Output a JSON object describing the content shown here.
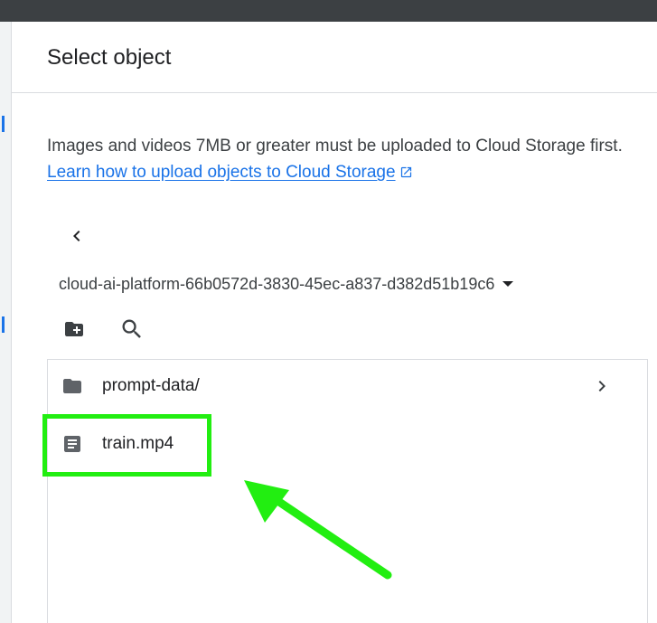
{
  "dialog": {
    "title": "Select object",
    "info_text": "Images and videos 7MB or greater must be uploaded to Cloud Storage first.",
    "info_link": "Learn how to upload objects to Cloud Storage"
  },
  "bucket": {
    "name": "cloud-ai-platform-66b0572d-3830-45ec-a837-d382d51b19c6"
  },
  "icons": {
    "back": "chevron-left-icon",
    "bucket_dropdown": "caret-down-icon",
    "new_folder": "new-folder-icon",
    "search": "search-icon",
    "external_link": "external-link-icon",
    "folder": "folder-icon",
    "file": "file-icon",
    "row_open": "chevron-right-icon"
  },
  "files": [
    {
      "name": "prompt-data/",
      "type": "folder"
    },
    {
      "name": "train.mp4",
      "type": "file"
    }
  ],
  "colors": {
    "link": "#1a73e8",
    "highlight": "#22ee11",
    "topbar": "#3c4043",
    "icon": "#5f6368"
  }
}
